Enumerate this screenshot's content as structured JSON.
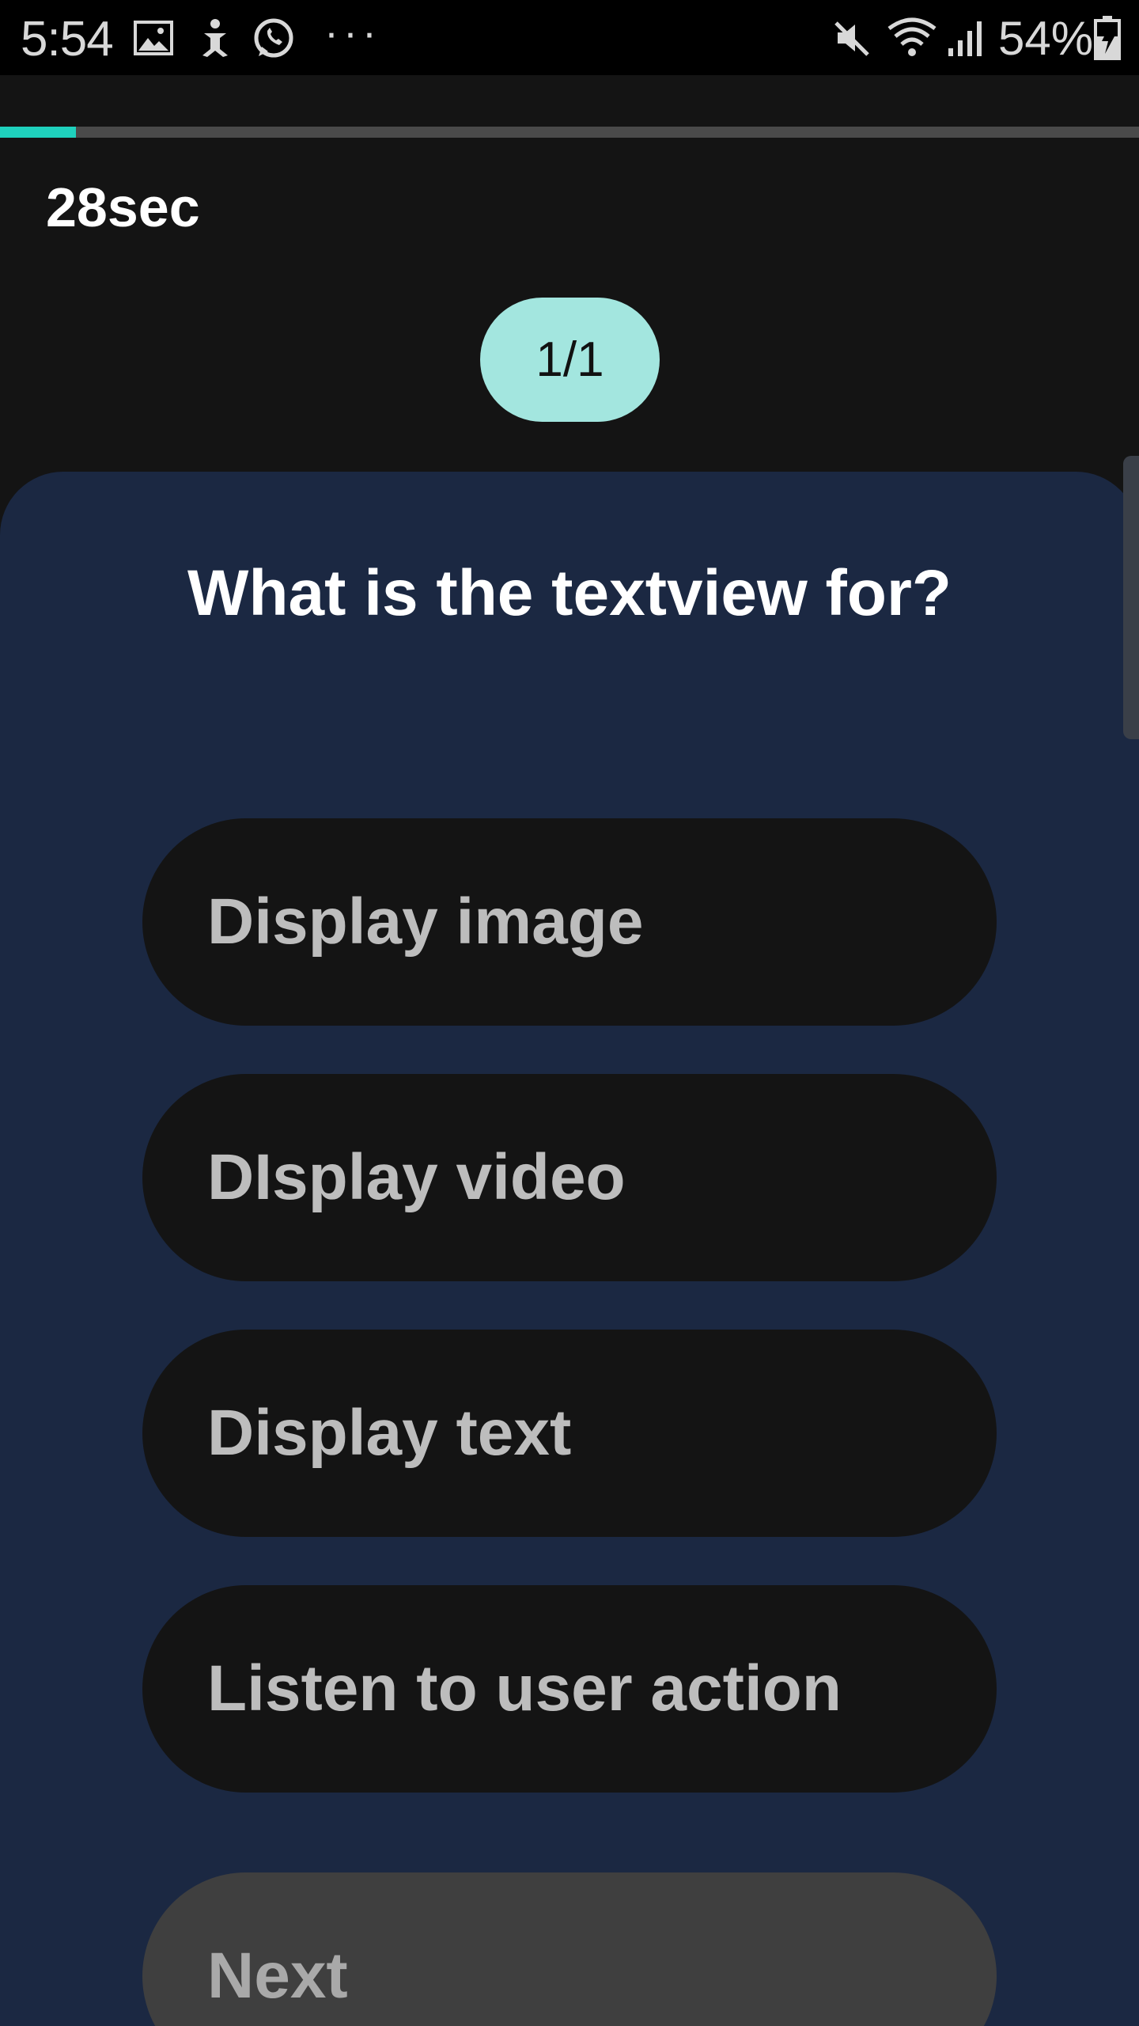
{
  "status_bar": {
    "time": "5:54",
    "dots": "···",
    "battery_percent": "54%",
    "icons": [
      "image-icon",
      "accessibility-icon",
      "whatsapp-icon",
      "mute-icon",
      "wifi-icon",
      "signal-icon",
      "battery-charging-icon"
    ]
  },
  "quiz": {
    "progress_fraction": 0.067,
    "timer": "28sec",
    "counter": "1/1",
    "question": "What is the textview for?",
    "options": [
      {
        "label": "Display image"
      },
      {
        "label": "DIsplay video"
      },
      {
        "label": "Display text"
      },
      {
        "label": "Listen to user action"
      }
    ],
    "next_label": "Next"
  },
  "colors": {
    "accent": "#1fd1bd",
    "pill": "#a3e6df",
    "card": "#1b2842",
    "background": "#141414"
  }
}
